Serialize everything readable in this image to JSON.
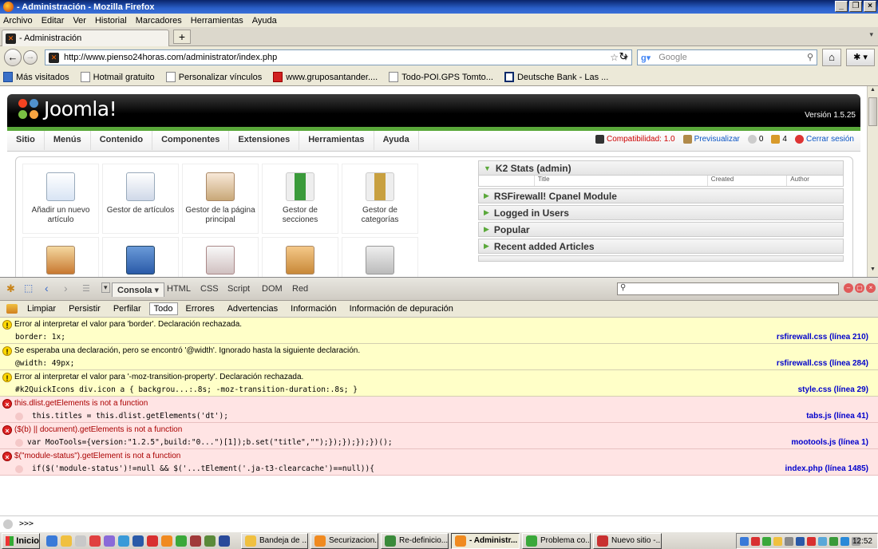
{
  "window": {
    "title": "- Administración - Mozilla Firefox"
  },
  "menubar": [
    "Archivo",
    "Editar",
    "Ver",
    "Historial",
    "Marcadores",
    "Herramientas",
    "Ayuda"
  ],
  "tab": {
    "label": "- Administración"
  },
  "nav": {
    "url": "http://www.pienso24horas.com/administrator/index.php",
    "search_engine": "Google",
    "search_placeholder": "Google"
  },
  "bookmarks": [
    "Más visitados",
    "Hotmail gratuito",
    "Personalizar vínculos",
    "www.gruposantander....",
    "Todo-POI.GPS Tomto...",
    "Deutsche Bank - Las ..."
  ],
  "joomla": {
    "logo": "Joomla!",
    "version": "Versión 1.5.25",
    "menu": [
      "Sitio",
      "Menús",
      "Contenido",
      "Componentes",
      "Extensiones",
      "Herramientas",
      "Ayuda"
    ],
    "status": {
      "compat": "Compatibilidad: 1.0",
      "preview": "Previsualizar",
      "messages": "0",
      "users": "4",
      "logout": "Cerrar sesión"
    },
    "quickicons": [
      "Añadir un nuevo artículo",
      "Gestor de artículos",
      "Gestor de la página principal",
      "Gestor de secciones",
      "Gestor de categorías"
    ],
    "modules": [
      "K2 Stats (admin)",
      "RSFirewall! Cpanel Module",
      "Logged in Users",
      "Popular",
      "Recent added Articles"
    ],
    "k2_columns": [
      "",
      "Title",
      "Created",
      "Author"
    ]
  },
  "firebug": {
    "tabs": [
      "Consola",
      "HTML",
      "CSS",
      "Script",
      "DOM",
      "Red"
    ],
    "subtoolbar": [
      "Limpiar",
      "Persistir",
      "Perfilar",
      "Todo",
      "Errores",
      "Advertencias",
      "Información",
      "Información de depuración"
    ],
    "entries": [
      {
        "type": "warn",
        "message": "Error al interpretar el valor para 'border'. Declaración rechazada.",
        "code": "border: 1x;",
        "source": "rsfirewall.css (línea 210)"
      },
      {
        "type": "warn",
        "message": "Se esperaba una declaración, pero se encontró '@width'. Ignorado hasta la siguiente declaración.",
        "code": "@width: 49px;",
        "source": "rsfirewall.css (línea 284)"
      },
      {
        "type": "warn",
        "message": "Error al interpretar el valor para '-moz-transition-property'. Declaración rechazada.",
        "code": "#k2QuickIcons div.icon a { backgrou...:.8s; -moz-transition-duration:.8s; }",
        "source": "style.css (línea 29)"
      },
      {
        "type": "err",
        "message": "this.dlist.getElements is not a function",
        "code": "this.titles = this.dlist.getElements('dt');",
        "source": "tabs.js (línea 41)"
      },
      {
        "type": "err",
        "message": "($(b) || document).getElements is not a function",
        "code": "var MooTools={version:\"1.2.5\",build:\"0...\")[1]);b.set(\"title\",\"\");});});});})();",
        "source": "mootools.js (línea 1)"
      },
      {
        "type": "err",
        "message": "$(\"module-status\").getElement is not a function",
        "code": "if($('module-status')!=null && $('...tElement('.ja-t3-clearcache')==null)){",
        "source": "index.php (línea 1485)"
      }
    ],
    "prompt": ">>>"
  },
  "taskbar": {
    "start": "Inicio",
    "tasks": [
      "Bandeja de ...",
      "Securizacion...",
      "Re-definicio...",
      "- Administr...",
      "Problema co...",
      "Nuevo sitio -..."
    ],
    "clock": "12:52"
  }
}
